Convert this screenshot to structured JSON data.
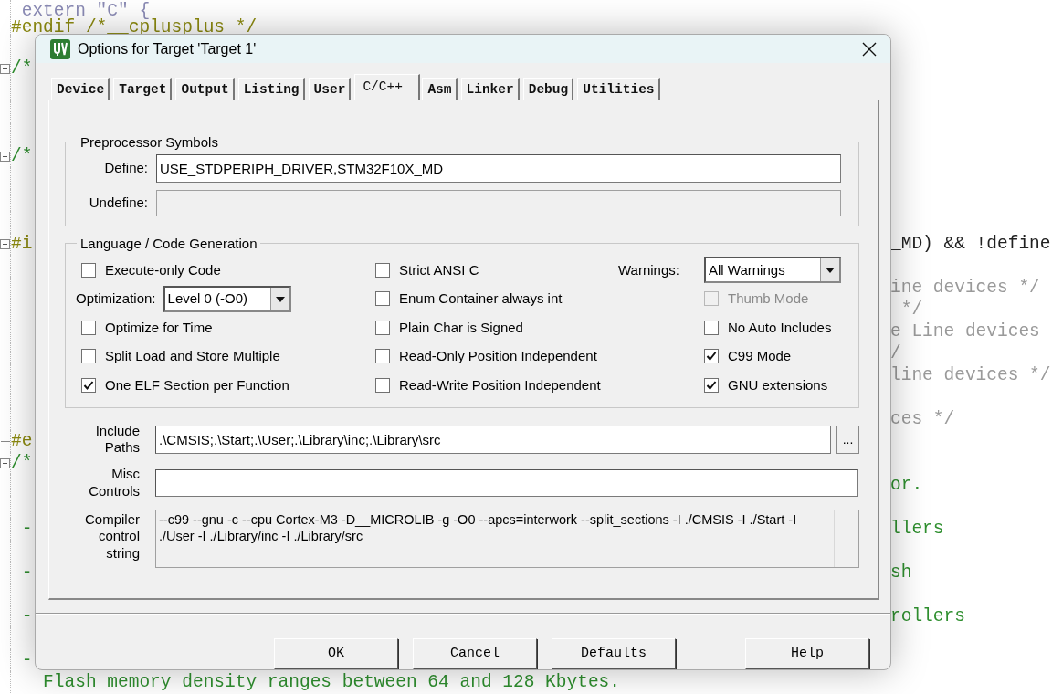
{
  "editor": {
    "lines": [
      {
        "kind": "text",
        "left": {
          "text": " extern \"C\" {",
          "kind": "muted"
        }
      },
      {
        "kind": "text",
        "left": {
          "text": "#endif /*__cplusplus */",
          "kind": "preproc"
        }
      },
      {
        "kind": "blank"
      },
      {
        "kind": "fold_start",
        "left": {
          "text": "/*",
          "kind": "comment"
        }
      },
      {
        "kind": "blank"
      },
      {
        "kind": "blank"
      },
      {
        "kind": "blank"
      },
      {
        "kind": "fold_start",
        "left": {
          "text": "/*",
          "kind": "comment"
        }
      },
      {
        "kind": "blank"
      },
      {
        "kind": "blank"
      },
      {
        "kind": "blank"
      },
      {
        "kind": "fold_start",
        "left": {
          "text": "#i",
          "kind": "preproc"
        },
        "right": {
          "text": "_MD) && !define",
          "kind": "code"
        }
      },
      {
        "kind": "blank"
      },
      {
        "kind": "text",
        "right": {
          "text": "ine devices */",
          "kind": "faded"
        }
      },
      {
        "kind": "text",
        "right": {
          "text": " */",
          "kind": "faded"
        }
      },
      {
        "kind": "text",
        "right": {
          "text": "e Line devices",
          "kind": "faded"
        }
      },
      {
        "kind": "text",
        "right": {
          "text": "/",
          "kind": "faded"
        }
      },
      {
        "kind": "text",
        "right": {
          "text": "line devices */",
          "kind": "faded"
        }
      },
      {
        "kind": "blank"
      },
      {
        "kind": "text",
        "right": {
          "text": "ces */",
          "kind": "faded"
        }
      },
      {
        "kind": "fold_end",
        "left": {
          "text": "#e",
          "kind": "preproc"
        }
      },
      {
        "kind": "fold_start",
        "left": {
          "text": "/*",
          "kind": "comment"
        }
      },
      {
        "kind": "text",
        "right": {
          "text": "or.",
          "kind": "comment"
        }
      },
      {
        "kind": "blank"
      },
      {
        "kind": "text",
        "left": {
          "text": " -",
          "kind": "comment"
        },
        "right": {
          "text": "llers",
          "kind": "comment"
        }
      },
      {
        "kind": "blank"
      },
      {
        "kind": "text",
        "left": {
          "text": " -",
          "kind": "comment"
        },
        "right": {
          "text": "sh",
          "kind": "comment"
        }
      },
      {
        "kind": "blank"
      },
      {
        "kind": "text",
        "left": {
          "text": " -",
          "kind": "comment"
        },
        "right": {
          "text": "rollers",
          "kind": "comment"
        }
      },
      {
        "kind": "blank"
      },
      {
        "kind": "text",
        "left": {
          "text": " -",
          "kind": "comment"
        }
      },
      {
        "kind": "text",
        "left": {
          "text": "   Flash memory density ranges between 64 and 128 Kbytes.",
          "kind": "comment"
        }
      }
    ]
  },
  "dialog": {
    "title": "Options for Target 'Target 1'",
    "tabs": [
      {
        "label": "Device",
        "selected": false
      },
      {
        "label": "Target",
        "selected": false
      },
      {
        "label": "Output",
        "selected": false
      },
      {
        "label": "Listing",
        "selected": false
      },
      {
        "label": "User",
        "selected": false
      },
      {
        "label": "C/C++",
        "selected": true
      },
      {
        "label": "Asm",
        "selected": false
      },
      {
        "label": "Linker",
        "selected": false
      },
      {
        "label": "Debug",
        "selected": false
      },
      {
        "label": "Utilities",
        "selected": false
      }
    ],
    "preprocessor": {
      "title": "Preprocessor Symbols",
      "define": {
        "label": "Define:",
        "value": "USE_STDPERIPH_DRIVER,STM32F10X_MD",
        "disabled": false
      },
      "undefine": {
        "label": "Undefine:",
        "disabled": true
      }
    },
    "language": {
      "title": "Language / Code Generation",
      "columns": [
        [
          {
            "kind": "checkbox",
            "label": "Execute-only Code",
            "checked": false,
            "disabled": false
          },
          {
            "kind": "select",
            "label": "Optimization:",
            "value": "Level 0 (-O0)"
          },
          {
            "kind": "checkbox",
            "label": "Optimize for Time",
            "checked": false,
            "disabled": false
          },
          {
            "kind": "checkbox",
            "label": "Split Load and Store Multiple",
            "checked": false,
            "disabled": false
          },
          {
            "kind": "checkbox",
            "label": "One ELF Section per Function",
            "checked": true,
            "disabled": false
          }
        ],
        [
          {
            "kind": "checkbox",
            "label": "Strict ANSI C",
            "checked": false,
            "disabled": false
          },
          {
            "kind": "checkbox",
            "label": "Enum Container always int",
            "checked": false,
            "disabled": false
          },
          {
            "kind": "checkbox",
            "label": "Plain Char is Signed",
            "checked": false,
            "disabled": false
          },
          {
            "kind": "checkbox",
            "label": "Read-Only Position Independent",
            "checked": false,
            "disabled": false
          },
          {
            "kind": "checkbox",
            "label": "Read-Write Position Independent",
            "checked": false,
            "disabled": false
          }
        ],
        [
          {
            "kind": "select",
            "label": "Warnings:",
            "value": "All Warnings"
          },
          {
            "kind": "checkbox",
            "label": "Thumb Mode",
            "checked": false,
            "disabled": true
          },
          {
            "kind": "checkbox",
            "label": "No Auto Includes",
            "checked": false,
            "disabled": false
          },
          {
            "kind": "checkbox",
            "label": "C99 Mode",
            "checked": true,
            "disabled": false
          },
          {
            "kind": "checkbox",
            "label": "GNU extensions",
            "checked": true,
            "disabled": false
          }
        ]
      ]
    },
    "include_paths": {
      "label": "Include Paths",
      "value": ".\\CMSIS;.\\Start;.\\User;.\\Library\\inc;.\\Library\\src",
      "browse": "..."
    },
    "misc_controls": {
      "label": "Misc Controls"
    },
    "compiler_string": {
      "label": "Compiler control string",
      "value": "--c99 --gnu -c --cpu Cortex-M3 -D__MICROLIB -g -O0 --apcs=interwork --split_sections -I ./CMSIS -I ./Start -I ./User -I ./Library/inc -I ./Library/src",
      "disabled": true
    },
    "buttons": [
      {
        "label": "OK",
        "kind": "main"
      },
      {
        "label": "Cancel",
        "kind": "main"
      },
      {
        "label": "Defaults",
        "kind": "main"
      },
      {
        "label": "Help",
        "kind": "aside"
      }
    ]
  }
}
